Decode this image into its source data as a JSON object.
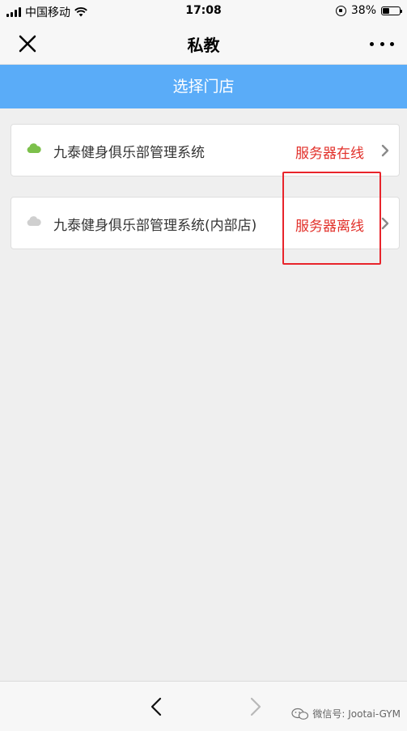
{
  "status_bar": {
    "carrier": "中国移动",
    "time": "17:08",
    "battery": "38%",
    "battery_level": 0.38
  },
  "nav": {
    "title": "私教",
    "close_icon": "close-icon",
    "more_icon": "more-icon"
  },
  "header": {
    "title": "选择门店",
    "background": "#5aacf8"
  },
  "stores": [
    {
      "name": "九泰健身俱乐部管理系统",
      "status": "服务器在线",
      "cloud_color": "#7cc04b",
      "icon": "cloud-icon"
    },
    {
      "name": "九泰健身俱乐部管理系统(内部店)",
      "status": "服务器离线",
      "cloud_color": "#cfcfcf",
      "icon": "cloud-icon"
    }
  ],
  "status_color": "#e2302a",
  "highlight_color": "#e8242b",
  "bottom_bar": {
    "back_icon": "chevron-left-icon",
    "forward_icon": "chevron-right-icon",
    "watermark": "微信号: Jootai-GYM"
  }
}
